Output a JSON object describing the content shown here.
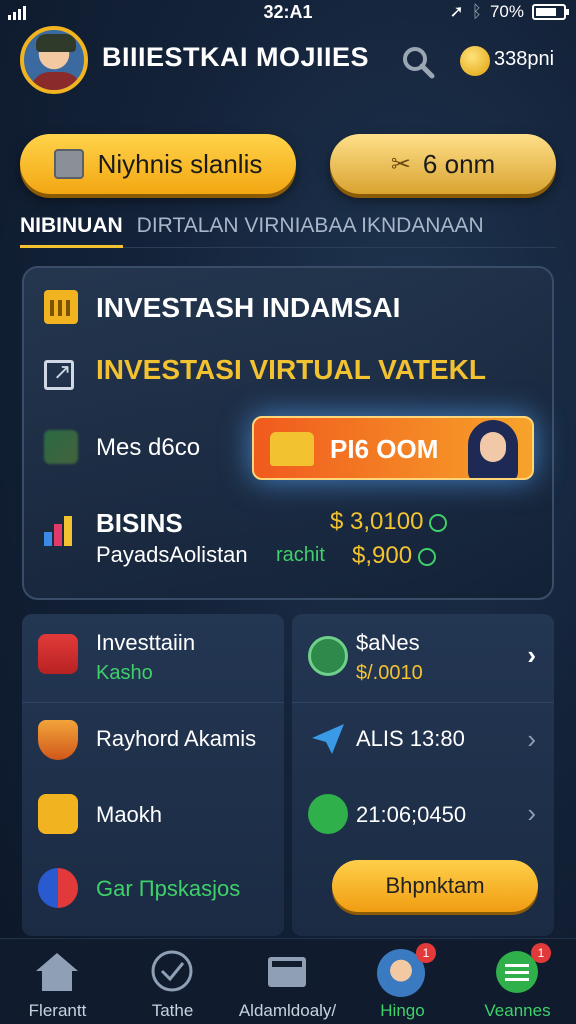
{
  "status_bar": {
    "time": "32:A1",
    "battery": "70%"
  },
  "header": {
    "title": "BIIIESTKAI MOJIIES",
    "coins": "338pni"
  },
  "actions": {
    "primary_label": "Niyhnis slanlis",
    "secondary_label": "6 onm"
  },
  "tabs": [
    {
      "label": "NIBINUAN",
      "active": true
    },
    {
      "label": "DIRTALAN VIRNIABAA IKNDANAAN",
      "active": false
    }
  ],
  "card": {
    "title": "INVESTASH INDAMSAI",
    "subtitle": "INVESTASI VIRTUAL VATEKL",
    "promo_label": "Mes d6co",
    "promo_button": "PI6 OOM",
    "biz_label": "BISINS",
    "biz_value": "$ 3,0100",
    "pay_label": "PayadsAolistan",
    "pay_tag": "rachit",
    "pay_value": "$,900"
  },
  "left_panel": {
    "items": [
      {
        "label": "Investtaiin",
        "sub": "Kasho",
        "icon": "wallet-icon"
      },
      {
        "label": "Rayhord Akamis",
        "icon": "shield-icon"
      },
      {
        "label": "Maokh",
        "icon": "clipboard-icon"
      },
      {
        "label": "Gar Πpskasjos",
        "icon": "music-icon"
      }
    ]
  },
  "right_panel": {
    "items": [
      {
        "label": "$aNes",
        "sub": "$/.0010",
        "icon": "p-coin-icon"
      },
      {
        "label": "ALIS 13:80",
        "icon": "paper-plane-icon"
      },
      {
        "label": "21:06;0450",
        "icon": "send-arrow-icon"
      }
    ],
    "button_label": "Bhpnktam"
  },
  "bottom_nav": [
    {
      "label": "Flerantt",
      "icon": "home-icon"
    },
    {
      "label": "Tathe",
      "icon": "check-circle-icon"
    },
    {
      "label": "Aldamldoaly/",
      "icon": "wallet-icon"
    },
    {
      "label": "Hingo",
      "icon": "avatar-icon",
      "badge": "1"
    },
    {
      "label": "Veannes",
      "icon": "list-icon",
      "badge": "1"
    }
  ],
  "colors": {
    "accent_gold": "#f2c230",
    "accent_green": "#3fd06a",
    "background": "#14233a"
  }
}
